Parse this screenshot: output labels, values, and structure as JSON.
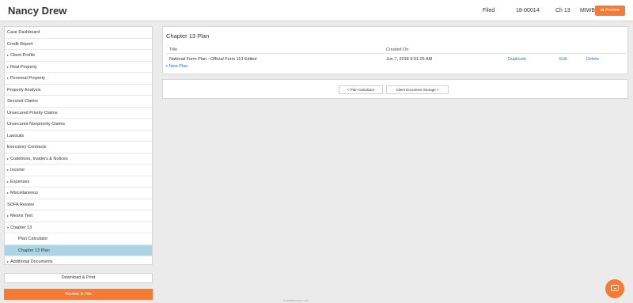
{
  "header": {
    "client_name": "Nancy Drew",
    "filed_label": "Filed",
    "case_number": "18-00014",
    "chapter": "Ch 13",
    "district": "MIWB",
    "preview_label": "Preview"
  },
  "sidebar": {
    "items": [
      {
        "label": "Case Dashboard",
        "caret": ""
      },
      {
        "label": "Credit Report",
        "caret": ""
      },
      {
        "label": "Client Profile",
        "caret": "▸"
      },
      {
        "label": "Real Property",
        "caret": "▸"
      },
      {
        "label": "Personal Property",
        "caret": "▸"
      },
      {
        "label": "Property Analysis",
        "caret": ""
      },
      {
        "label": "Secured Claims",
        "caret": ""
      },
      {
        "label": "Unsecured Priority Claims",
        "caret": ""
      },
      {
        "label": "Unsecured Nonpriority Claims",
        "caret": ""
      },
      {
        "label": "Lawsuits",
        "caret": ""
      },
      {
        "label": "Executory Contracts",
        "caret": ""
      },
      {
        "label": "Codebtors, Insiders & Notices",
        "caret": "▸"
      },
      {
        "label": "Income",
        "caret": "▸"
      },
      {
        "label": "Expenses",
        "caret": "▸"
      },
      {
        "label": "Miscellaneous",
        "caret": "▸"
      },
      {
        "label": "SOFA Review",
        "caret": ""
      },
      {
        "label": "Means Test",
        "caret": "▸"
      },
      {
        "label": "Chapter 13",
        "caret": "▾"
      },
      {
        "label": "Plan Calculator",
        "caret": ""
      },
      {
        "label": "Chapter 13 Plan",
        "caret": ""
      },
      {
        "label": "Additional Documents",
        "caret": "▸"
      }
    ],
    "download_label": "Download & Print",
    "review_label": "Review & File"
  },
  "main": {
    "panel_title": "Chapter 13 Plan",
    "columns": [
      "Title",
      "Created On"
    ],
    "rows": [
      {
        "title": "National Form Plan - Official Form 113 Edited",
        "created": "Jun 7, 2018 9:01:25 AM",
        "duplicate": "Duplicate",
        "edit": "Edit",
        "delete": "Delete"
      }
    ],
    "new_plan_label": "+ New Plan",
    "prev_button": "< Plan Calculator",
    "next_button": "Client Document Storage >"
  },
  "footer_text": "© 2018 Best Case, LLC",
  "colors": {
    "accent": "#f47b36",
    "link": "#2b78b4",
    "active_row": "#acd3e6"
  },
  "icons": {
    "preview": "document-icon",
    "chat": "chat-bubble-icon"
  }
}
